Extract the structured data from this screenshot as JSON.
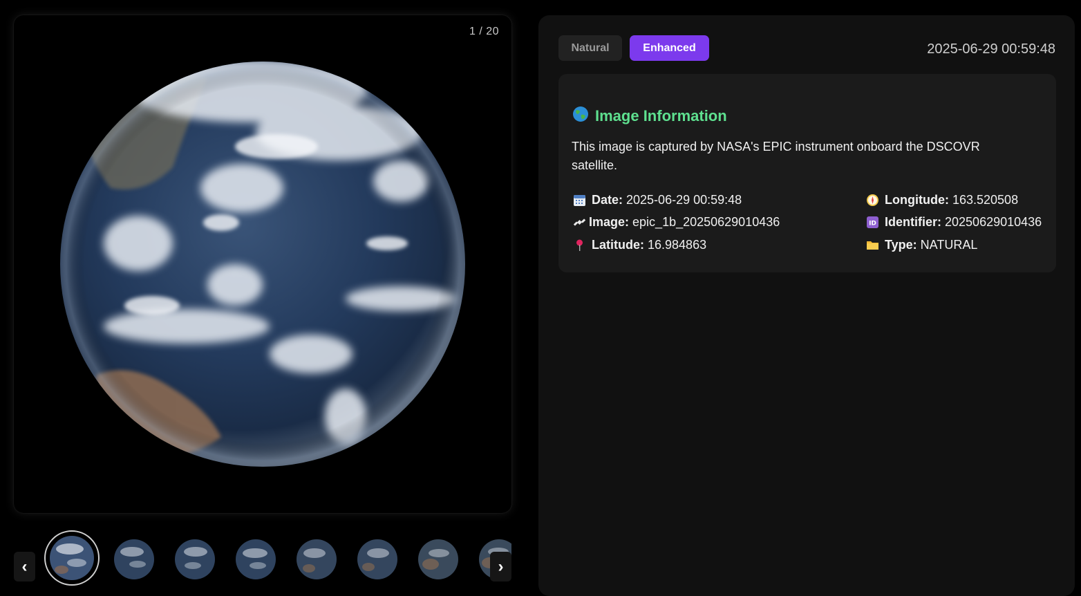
{
  "viewer": {
    "counter": "1 / 20"
  },
  "thumbnails": {
    "prev_label": "‹",
    "next_label": "›",
    "count_visible": 8
  },
  "panel": {
    "toggle_natural": "Natural",
    "toggle_enhanced": "Enhanced",
    "active_toggle": "Enhanced",
    "timestamp": "2025-06-29 00:59:48"
  },
  "info": {
    "title_icon": "globe-icon",
    "title": "Image Information",
    "description": "This image is captured by NASA's EPIC instrument onboard the DSCOVR satellite.",
    "fields": {
      "date": {
        "icon": "calendar-icon",
        "label": "Date:",
        "value": "2025-06-29 00:59:48"
      },
      "image": {
        "icon": "satellite-icon",
        "label": "Image:",
        "value": "epic_1b_20250629010436"
      },
      "latitude": {
        "icon": "pin-icon",
        "label": "Latitude:",
        "value": "16.984863"
      },
      "longitude": {
        "icon": "compass-icon",
        "label": "Longitude:",
        "value": "163.520508"
      },
      "identifier": {
        "icon": "id-icon",
        "label": "Identifier:",
        "value": "20250629010436"
      },
      "type": {
        "icon": "folder-icon",
        "label": "Type:",
        "value": "NATURAL"
      }
    }
  },
  "colors": {
    "accent_purple": "#7c3aed",
    "title_green": "#5ee08f",
    "panel_bg": "#111111",
    "card_bg": "#1b1b1b"
  }
}
